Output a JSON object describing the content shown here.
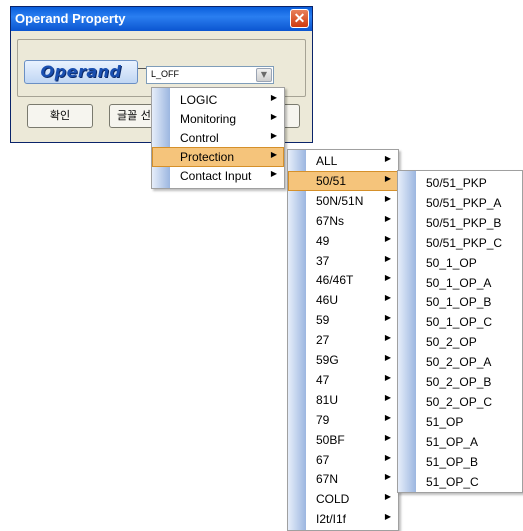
{
  "dialog": {
    "title": "Operand Property",
    "close_label": "✕",
    "logo_text": "Operand",
    "combo_value": "L_OFF",
    "combo_dropdown_glyph": "▼",
    "ok_label": "확인",
    "font_label": "글꼴 선"
  },
  "menu1": {
    "items": [
      {
        "label": "LOGIC"
      },
      {
        "label": "Monitoring"
      },
      {
        "label": "Control"
      },
      {
        "label": "Protection"
      },
      {
        "label": "Contact Input"
      }
    ],
    "selected": "Protection"
  },
  "menu2": {
    "items": [
      {
        "label": "ALL"
      },
      {
        "label": "50/51"
      },
      {
        "label": "50N/51N"
      },
      {
        "label": "67Ns"
      },
      {
        "label": "49"
      },
      {
        "label": "37"
      },
      {
        "label": "46/46T"
      },
      {
        "label": "46U"
      },
      {
        "label": "59"
      },
      {
        "label": "27"
      },
      {
        "label": "59G"
      },
      {
        "label": "47"
      },
      {
        "label": "81U"
      },
      {
        "label": "79"
      },
      {
        "label": "50BF"
      },
      {
        "label": "67"
      },
      {
        "label": "67N"
      },
      {
        "label": "COLD"
      },
      {
        "label": "I2t/I1f"
      }
    ],
    "selected": "50/51"
  },
  "menu3": {
    "items": [
      {
        "label": "50/51_PKP"
      },
      {
        "label": "50/51_PKP_A"
      },
      {
        "label": "50/51_PKP_B"
      },
      {
        "label": "50/51_PKP_C"
      },
      {
        "label": "50_1_OP"
      },
      {
        "label": "50_1_OP_A"
      },
      {
        "label": "50_1_OP_B"
      },
      {
        "label": "50_1_OP_C"
      },
      {
        "label": "50_2_OP"
      },
      {
        "label": "50_2_OP_A"
      },
      {
        "label": "50_2_OP_B"
      },
      {
        "label": "50_2_OP_C"
      },
      {
        "label": "51_OP"
      },
      {
        "label": "51_OP_A"
      },
      {
        "label": "51_OP_B"
      },
      {
        "label": "51_OP_C"
      }
    ]
  },
  "colors": {
    "title_bar": "#0a5fdc",
    "menu_highlight": "#f5c47b",
    "menu_stripe": "#9cb6e0"
  }
}
